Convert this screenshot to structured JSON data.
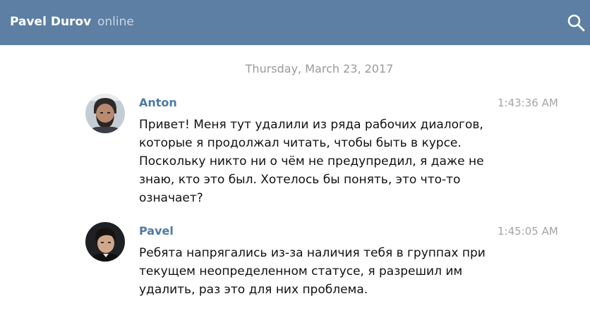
{
  "header": {
    "name": "Pavel Durov",
    "status": "online"
  },
  "date_separator": "Thursday, March 23, 2017",
  "messages": [
    {
      "author": "Anton",
      "time": "1:43:36 AM",
      "text": "Привет! Меня тут удалили из ряда рабочих диалогов, которые я продолжал читать, чтобы быть в курсе. Поскольку никто ни о чём не предупредил, я даже не знаю, кто это был. Хотелось бы понять, это что-то означает?"
    },
    {
      "author": "Pavel",
      "time": "1:45:05 AM",
      "text": "Ребята напрягались из-за наличия тебя в группах при текущем неопределенном статусе, я разрешил им удалить, раз это для них проблема."
    }
  ],
  "colors": {
    "header_bg": "#5c7fa3",
    "author": "#4e7aa3",
    "date_text": "#9a9a9a",
    "time_text": "#a5a5a5"
  },
  "icons": {
    "search": "search-icon"
  }
}
